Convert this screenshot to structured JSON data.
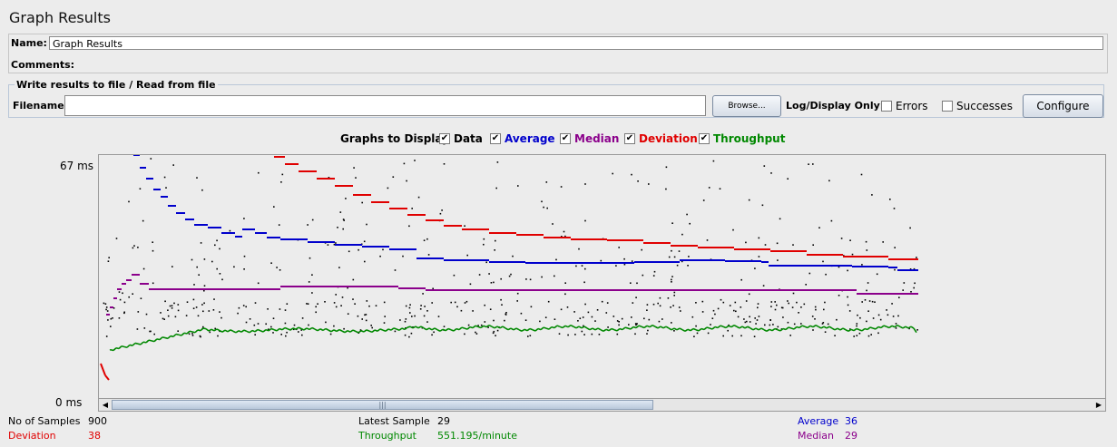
{
  "header": {
    "title": "Graph Results"
  },
  "form": {
    "name_label": "Name:",
    "name_value": "Graph Results",
    "comments_label": "Comments:"
  },
  "file_panel": {
    "legend": "Write results to file / Read from file",
    "filename_label": "Filename",
    "filename_value": "",
    "browse_label": "Browse...",
    "log_display_label": "Log/Display Only:",
    "errors_label": "Errors",
    "errors_checked": false,
    "successes_label": "Successes",
    "successes_checked": false,
    "configure_label": "Configure"
  },
  "graphs_to_display": {
    "label": "Graphs to Display",
    "options": [
      {
        "label": "Data",
        "checked": true,
        "color": "#000000"
      },
      {
        "label": "Average",
        "checked": true,
        "color": "#0000cc"
      },
      {
        "label": "Median",
        "checked": true,
        "color": "#8b008b"
      },
      {
        "label": "Deviation",
        "checked": true,
        "color": "#e00000"
      },
      {
        "label": "Throughput",
        "checked": true,
        "color": "#008800"
      }
    ]
  },
  "graph": {
    "y_max_label": "67  ms",
    "y_min_label": "0  ms"
  },
  "stats": {
    "samples_label": "No of Samples",
    "samples_value": "900",
    "deviation_label": "Deviation",
    "deviation_value": "38",
    "latest_label": "Latest Sample",
    "latest_value": "29",
    "throughput_label": "Throughput",
    "throughput_value": "551.195/minute",
    "average_label": "Average",
    "average_value": "36",
    "median_label": "Median",
    "median_value": "29"
  },
  "colors": {
    "data": "#000000",
    "average": "#0000cc",
    "median": "#8b008b",
    "deviation": "#e00000",
    "throughput": "#008800"
  }
}
